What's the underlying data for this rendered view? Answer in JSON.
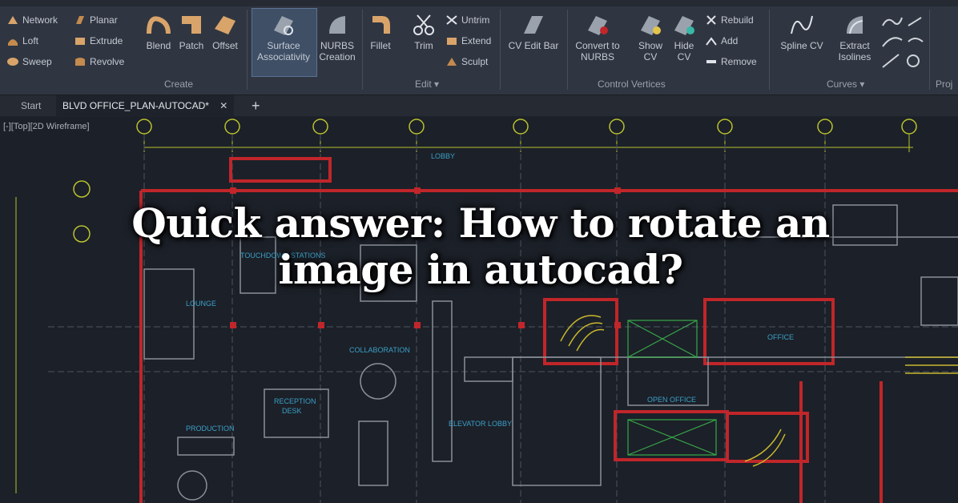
{
  "ribbon": {
    "panels": [
      {
        "title": "Create"
      },
      {
        "title": "Edit"
      },
      {
        "title": "Control Vertices"
      },
      {
        "title": "Curves"
      },
      {
        "title": "Proj"
      }
    ],
    "tools": {
      "network": "Network",
      "planar": "Planar",
      "loft": "Loft",
      "extrude": "Extrude",
      "sweep": "Sweep",
      "revolve": "Revolve",
      "blend": "Blend",
      "patch": "Patch",
      "offset": "Offset",
      "surface_associativity_1": "Surface",
      "surface_associativity_2": "Associativity",
      "nurbs_creation_1": "NURBS",
      "nurbs_creation_2": "Creation",
      "fillet": "Fillet",
      "trim": "Trim",
      "untrim": "Untrim",
      "extend": "Extend",
      "sculpt": "Sculpt",
      "cv_edit_bar": "CV Edit Bar",
      "convert_nurbs_1": "Convert to",
      "convert_nurbs_2": "NURBS",
      "show_cv_1": "Show",
      "show_cv_2": "CV",
      "hide_cv_1": "Hide",
      "hide_cv_2": "CV",
      "rebuild": "Rebuild",
      "add": "Add",
      "remove": "Remove",
      "spline_cv": "Spline CV",
      "extract_isolines_1": "Extract",
      "extract_isolines_2": "Isolines"
    },
    "edit_dropdown": "Edit ▾",
    "cv_title": "Control Vertices",
    "curves_dropdown": "Curves ▾"
  },
  "tabs": {
    "start": "Start",
    "document": "BLVD OFFICE_PLAN-AUTOCAD*",
    "close": "✕",
    "new": "+"
  },
  "viewport": {
    "label": "[-][Top][2D Wireframe]"
  },
  "plan_labels": {
    "lobby": "LOBBY",
    "touchdown": "TOUCHDOWN STATIONS",
    "lounge": "LOUNGE",
    "collaboration": "COLLABORATION",
    "reception": "RECEPTION",
    "reception_sub": "DESK",
    "elevator_lobby": "ELEVATOR LOBBY",
    "production": "PRODUCTION",
    "open_office": "OPEN OFFICE",
    "office": "OFFICE"
  },
  "headline": {
    "line1": "Quick answer: How to rotate an",
    "line2": "image in autocad?"
  },
  "colors": {
    "ribbon_bg": "#303641",
    "canvas_bg": "#1c2028",
    "plan_yellow": "#b8c22e",
    "plan_red": "#c0262a",
    "plan_cyan": "#3aa0c8",
    "plan_gray": "#8a8f98",
    "plan_green": "#38a84a"
  }
}
